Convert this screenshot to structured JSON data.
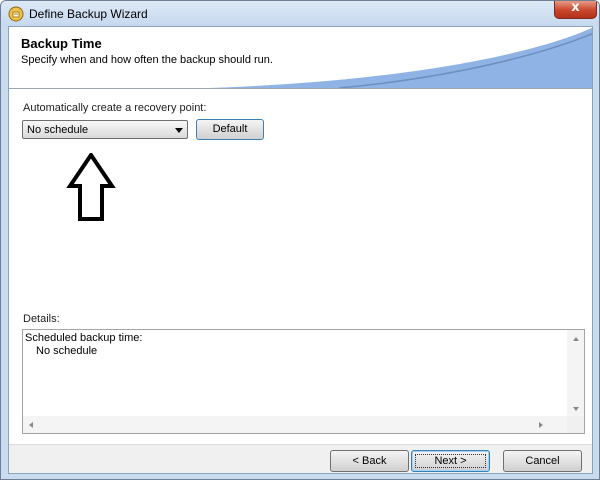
{
  "window": {
    "title": "Define Backup Wizard",
    "close_glyph": "x",
    "app_icon": "backup-wizard-icon"
  },
  "header": {
    "title": "Backup Time",
    "subtitle": "Specify when and how often the backup should run."
  },
  "schedule": {
    "label": "Automatically create a recovery point:",
    "selected": "No schedule",
    "default_button": "Default"
  },
  "details": {
    "label": "Details:",
    "line1": "Scheduled backup time:",
    "line2": "No schedule"
  },
  "footer": {
    "back": "< Back",
    "next": "Next >",
    "cancel": "Cancel"
  },
  "colors": {
    "accent_blue": "#8eb3e4",
    "header_curve": "#6f8fbf",
    "close_red": "#c9462c"
  }
}
